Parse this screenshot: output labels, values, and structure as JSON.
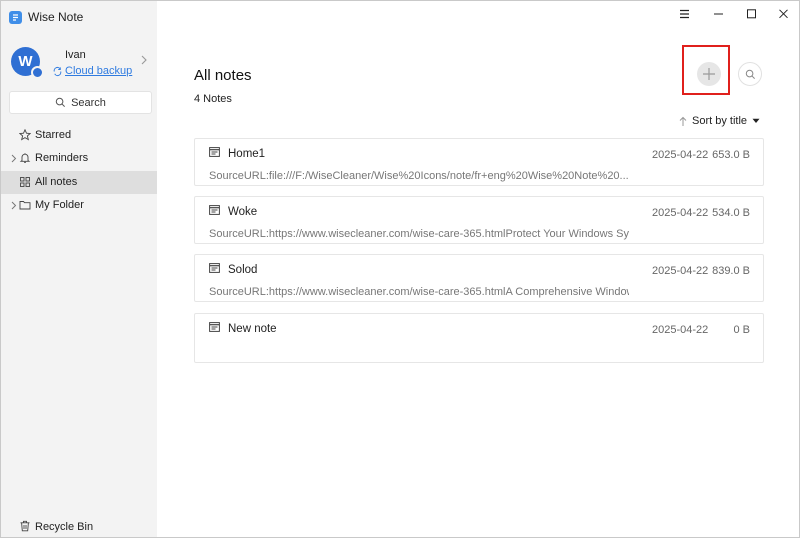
{
  "app": {
    "title": "Wise Note"
  },
  "user": {
    "avatar_letter": "W",
    "name": "Ivan",
    "cloud_label": "Cloud backup"
  },
  "sidebar": {
    "search_label": "Search",
    "items": [
      {
        "label": "Starred",
        "icon": "star-icon"
      },
      {
        "label": "Reminders",
        "icon": "bell-icon"
      },
      {
        "label": "All notes",
        "icon": "grid-icon",
        "active": true
      },
      {
        "label": "My Folder",
        "icon": "folder-icon"
      }
    ],
    "recycle_label": "Recycle Bin"
  },
  "main": {
    "title": "All notes",
    "count": "4 Notes",
    "sort_label": "Sort by title",
    "notes": [
      {
        "title": "Home1",
        "date": "2025-04-22",
        "size": "653.0 B",
        "snippet": "SourceURL:file:///F:/WiseCleaner/Wise%20Icons/note/fr+eng%20Wise%20Note%20..."
      },
      {
        "title": "Woke",
        "date": "2025-04-22",
        "size": "534.0 B",
        "snippet": "SourceURL:https://www.wisecleaner.com/wise-care-365.htmlProtect Your Windows Sys..."
      },
      {
        "title": "Solod",
        "date": "2025-04-22",
        "size": "839.0 B",
        "snippet": "SourceURL:https://www.wisecleaner.com/wise-care-365.htmlA Comprehensive Window..."
      },
      {
        "title": "New note",
        "date": "2025-04-22",
        "size": "0 B",
        "snippet": ""
      }
    ]
  },
  "colors": {
    "accent": "#2f7be0",
    "highlight": "#e0201c",
    "sidebar_bg": "#f3f3f3",
    "active_bg": "#dedede"
  }
}
